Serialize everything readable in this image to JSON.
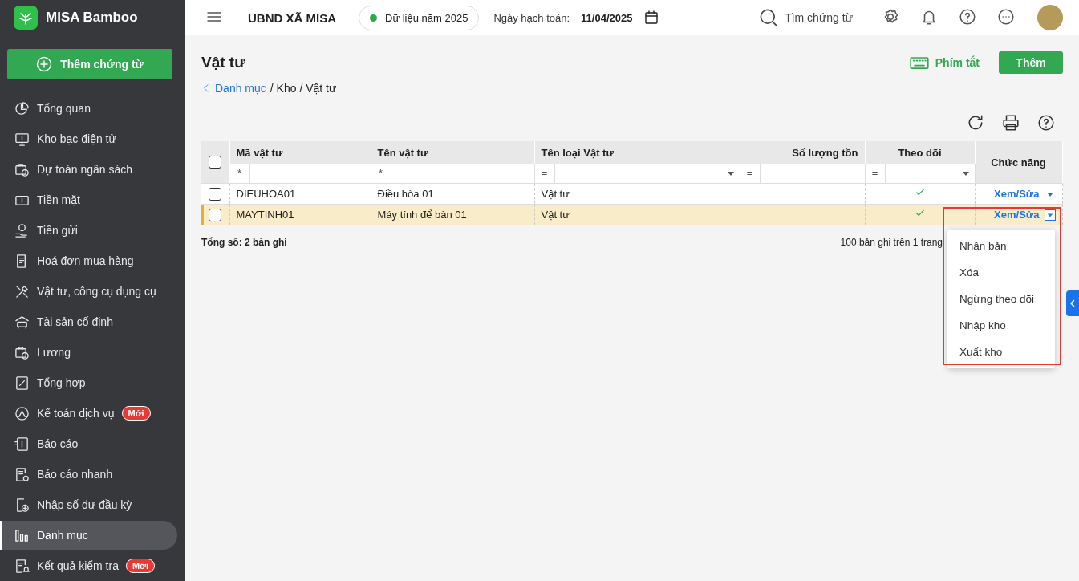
{
  "sidebar": {
    "logo": "MISA Bamboo",
    "add_button": "Thêm chứng từ",
    "items": [
      {
        "label": "Tổng quan",
        "selected": false
      },
      {
        "label": "Kho bạc điện tử",
        "selected": false
      },
      {
        "label": "Dự toán ngân sách",
        "selected": false
      },
      {
        "label": "Tiền mặt",
        "selected": false
      },
      {
        "label": "Tiền gửi",
        "selected": false
      },
      {
        "label": "Hoá đơn mua hàng",
        "selected": false
      },
      {
        "label": "Vật tư, công cụ dụng cụ",
        "selected": false
      },
      {
        "label": "Tài sản cố định",
        "selected": false
      },
      {
        "label": "Lương",
        "selected": false
      },
      {
        "label": "Tổng hợp",
        "selected": false
      },
      {
        "label": "Kế toán dịch vụ",
        "selected": false,
        "badge": "Mới"
      },
      {
        "label": "Báo cáo",
        "selected": false
      },
      {
        "label": "Báo cáo nhanh",
        "selected": false
      },
      {
        "label": "Nhập số dư đầu kỳ",
        "selected": false
      },
      {
        "label": "Danh mục",
        "selected": true
      },
      {
        "label": "Kết quả kiểm tra",
        "selected": false,
        "badge": "Mới"
      }
    ]
  },
  "topbar": {
    "organization": "UBND XÃ MISA",
    "data_year": "Dữ liệu năm 2025",
    "date_label": "Ngày hạch toán:",
    "date": "11/04/2025",
    "search": "Tìm chứng từ"
  },
  "page": {
    "title": "Vật tư",
    "breadcrumb_link": "Danh mục",
    "breadcrumb_path": "/ Kho / Vật tư",
    "shortcut_button": "Phím tắt",
    "add_button": "Thêm"
  },
  "table": {
    "header_checked": false,
    "columns": [
      {
        "label": "Mã vật tư",
        "kind": "text",
        "filter": "*",
        "dropdown": false
      },
      {
        "label": "Tên vật tư",
        "kind": "text",
        "filter": "*",
        "dropdown": false
      },
      {
        "label": "Tên loại Vật tư",
        "kind": "text",
        "filter": "=",
        "dropdown": true
      },
      {
        "label": "Số lượng tồn",
        "kind": "number",
        "filter": "=",
        "dropdown": false
      },
      {
        "label": "Theo dõi",
        "kind": "flag",
        "filter": "=",
        "dropdown": true
      }
    ],
    "action_column": "Chức năng",
    "rows": [
      {
        "code": "DIEUHOA01",
        "name": "Điều hòa 01",
        "type": "Vật tư",
        "tracked": true,
        "checked": false,
        "selected": false,
        "action": "Xem/Sửa",
        "menu_open": false
      },
      {
        "code": "MAYTINH01",
        "name": "Máy tính để bàn 01",
        "type": "Vật tư",
        "tracked": true,
        "checked": false,
        "selected": true,
        "action": "Xem/Sửa",
        "menu_open": true
      }
    ],
    "total": "Tổng số: 2 bản ghi",
    "paging": "100 bản ghi trên 1 trang"
  },
  "action_menu": [
    "Nhân bản",
    "Xóa",
    "Ngừng theo dõi",
    "Nhập kho",
    "Xuất kho"
  ]
}
